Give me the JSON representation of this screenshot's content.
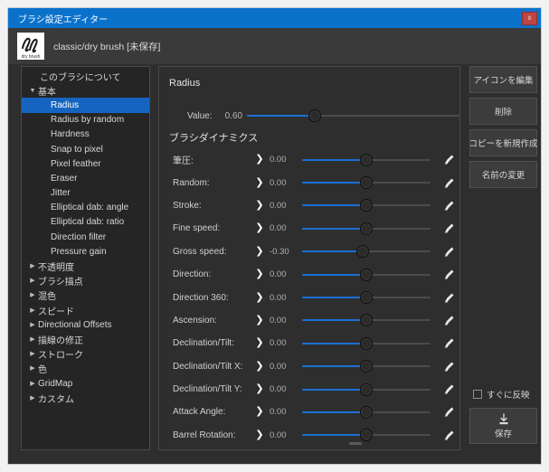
{
  "window": {
    "title": "ブラシ設定エディター",
    "close_label": "x",
    "accent": "#0b72cc",
    "selection_color": "#1565c0",
    "slider_fill": "#1a6fd4"
  },
  "brush_header": {
    "name": "classic/dry brush [未保存]",
    "thumb_caption": "dry brush",
    "icon": "brush-thumbnail-icon"
  },
  "sidebar": {
    "items": [
      {
        "label": "このブラシについて",
        "level": 0,
        "caret": "",
        "selected": false
      },
      {
        "label": "基本",
        "level": 0,
        "caret": "open",
        "selected": false
      },
      {
        "label": "Radius",
        "level": 1,
        "caret": "",
        "selected": true
      },
      {
        "label": "Radius by random",
        "level": 1,
        "caret": "",
        "selected": false
      },
      {
        "label": "Hardness",
        "level": 1,
        "caret": "",
        "selected": false
      },
      {
        "label": "Snap to pixel",
        "level": 1,
        "caret": "",
        "selected": false
      },
      {
        "label": "Pixel feather",
        "level": 1,
        "caret": "",
        "selected": false
      },
      {
        "label": "Eraser",
        "level": 1,
        "caret": "",
        "selected": false
      },
      {
        "label": "Jitter",
        "level": 1,
        "caret": "",
        "selected": false
      },
      {
        "label": "Elliptical dab: angle",
        "level": 1,
        "caret": "",
        "selected": false
      },
      {
        "label": "Elliptical dab: ratio",
        "level": 1,
        "caret": "",
        "selected": false
      },
      {
        "label": "Direction filter",
        "level": 1,
        "caret": "",
        "selected": false
      },
      {
        "label": "Pressure gain",
        "level": 1,
        "caret": "",
        "selected": false
      },
      {
        "label": "不透明度",
        "level": 0,
        "caret": "closed",
        "selected": false
      },
      {
        "label": "ブラシ描点",
        "level": 0,
        "caret": "closed",
        "selected": false
      },
      {
        "label": "混色",
        "level": 0,
        "caret": "closed",
        "selected": false
      },
      {
        "label": "スピード",
        "level": 0,
        "caret": "closed",
        "selected": false
      },
      {
        "label": "Directional Offsets",
        "level": 0,
        "caret": "closed",
        "selected": false
      },
      {
        "label": "描線の修正",
        "level": 0,
        "caret": "closed",
        "selected": false
      },
      {
        "label": "ストローク",
        "level": 0,
        "caret": "closed",
        "selected": false
      },
      {
        "label": "色",
        "level": 0,
        "caret": "closed",
        "selected": false
      },
      {
        "label": "GridMap",
        "level": 0,
        "caret": "closed",
        "selected": false
      },
      {
        "label": "カスタム",
        "level": 0,
        "caret": "closed",
        "selected": false
      }
    ]
  },
  "main": {
    "setting_title": "Radius",
    "value_label": "Value:",
    "value_number": "0.60",
    "value_slider_pct": 32,
    "dynamics_title": "ブラシダイナミクス",
    "dynamics": [
      {
        "label": "筆圧:",
        "value": "0.00",
        "pct": 50
      },
      {
        "label": "Random:",
        "value": "0.00",
        "pct": 50
      },
      {
        "label": "Stroke:",
        "value": "0.00",
        "pct": 50
      },
      {
        "label": "Fine speed:",
        "value": "0.00",
        "pct": 50
      },
      {
        "label": "Gross speed:",
        "value": "-0.30",
        "pct": 47
      },
      {
        "label": "Direction:",
        "value": "0.00",
        "pct": 50
      },
      {
        "label": "Direction 360:",
        "value": "0.00",
        "pct": 50
      },
      {
        "label": "Ascension:",
        "value": "0.00",
        "pct": 50
      },
      {
        "label": "Declination/Tilt:",
        "value": "0.00",
        "pct": 50
      },
      {
        "label": "Declination/Tilt X:",
        "value": "0.00",
        "pct": 50
      },
      {
        "label": "Declination/Tilt Y:",
        "value": "0.00",
        "pct": 50
      },
      {
        "label": "Attack Angle:",
        "value": "0.00",
        "pct": 50
      },
      {
        "label": "Barrel Rotation:",
        "value": "0.00",
        "pct": 50
      }
    ],
    "expand_icon": "chevron-right-icon",
    "reset_icon": "brush-reset-icon"
  },
  "right_panel": {
    "buttons": [
      {
        "label": "アイコンを編集",
        "name": "edit-icon-button"
      },
      {
        "label": "削除",
        "name": "delete-button"
      },
      {
        "label": "コピーを新規作成",
        "name": "duplicate-button"
      },
      {
        "label": "名前の変更",
        "name": "rename-button"
      }
    ],
    "checkbox_label": "すぐに反映",
    "checkbox_checked": false,
    "save_label": "保存",
    "save_icon": "save-disk-icon"
  }
}
